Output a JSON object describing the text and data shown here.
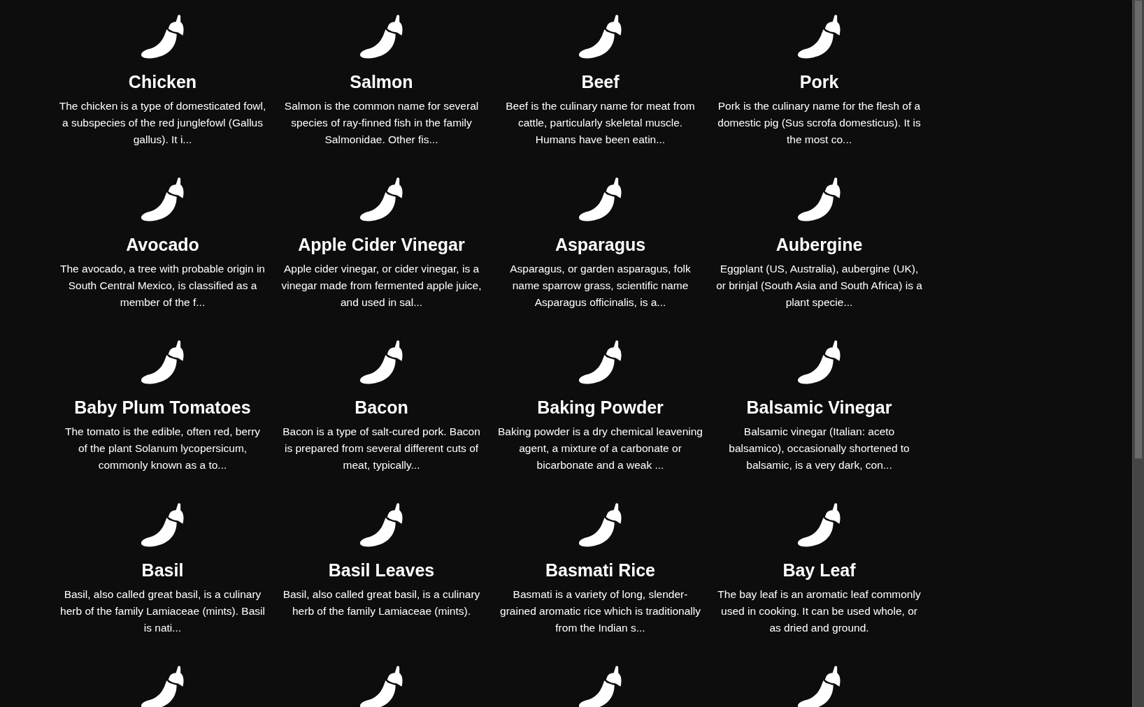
{
  "cards": [
    {
      "kind": "full",
      "title": "Chicken",
      "description": "The chicken is a type of domesticated fowl, a subspecies of the red junglefowl (Gallus gallus). It i..."
    },
    {
      "kind": "full",
      "title": "Salmon",
      "description": "Salmon is the common name for several species of ray-finned fish in the family Salmonidae. Other fis..."
    },
    {
      "kind": "full",
      "title": "Beef",
      "description": "Beef is the culinary name for meat from cattle, particularly skeletal muscle. Humans have been eatin..."
    },
    {
      "kind": "full",
      "title": "Pork",
      "description": "Pork is the culinary name for the flesh of a domestic pig (Sus scrofa domesticus). It is the most co..."
    },
    {
      "kind": "full",
      "title": "Avocado",
      "description": "The avocado, a tree with probable origin in South Central Mexico, is classified as a member of the f..."
    },
    {
      "kind": "full",
      "title": "Apple Cider Vinegar",
      "description": "Apple cider vinegar, or cider vinegar, is a vinegar made from fermented apple juice, and used in sal..."
    },
    {
      "kind": "full",
      "title": "Asparagus",
      "description": "Asparagus, or garden asparagus, folk name sparrow grass, scientific name Asparagus officinalis, is a..."
    },
    {
      "kind": "full",
      "title": "Aubergine",
      "description": "Eggplant (US, Australia), aubergine (UK), or brinjal (South Asia and South Africa) is a plant specie..."
    },
    {
      "kind": "full",
      "title": "Baby Plum Tomatoes",
      "description": "The tomato is the edible, often red, berry of the plant Solanum lycopersicum, commonly known as a to..."
    },
    {
      "kind": "full",
      "title": "Bacon",
      "description": "Bacon is a type of salt-cured pork. Bacon is prepared from several different cuts of meat, typically..."
    },
    {
      "kind": "full",
      "title": "Baking Powder",
      "description": "Baking powder is a dry chemical leavening agent, a mixture of a carbonate or bicarbonate and a weak ..."
    },
    {
      "kind": "full",
      "title": "Balsamic Vinegar",
      "description": "Balsamic vinegar (Italian: aceto balsamico), occasionally shortened to balsamic, is a very dark, con..."
    },
    {
      "kind": "full",
      "title": "Basil",
      "description": "Basil, also called great basil, is a culinary herb of the family Lamiaceae (mints). Basil is nati..."
    },
    {
      "kind": "full",
      "title": "Basil Leaves",
      "description": "Basil, also called great basil, is a culinary herb of the family Lamiaceae (mints)."
    },
    {
      "kind": "full",
      "title": "Basmati Rice",
      "description": "Basmati is a variety of long, slender-grained aromatic rice which is traditionally from the Indian s..."
    },
    {
      "kind": "full",
      "title": "Bay Leaf",
      "description": "The bay leaf is an aromatic leaf commonly used in cooking. It can be used whole, or as dried and ground."
    },
    {
      "kind": "cut-off"
    },
    {
      "kind": "cut-off"
    },
    {
      "kind": "cut-off"
    },
    {
      "kind": "cut-off"
    }
  ]
}
